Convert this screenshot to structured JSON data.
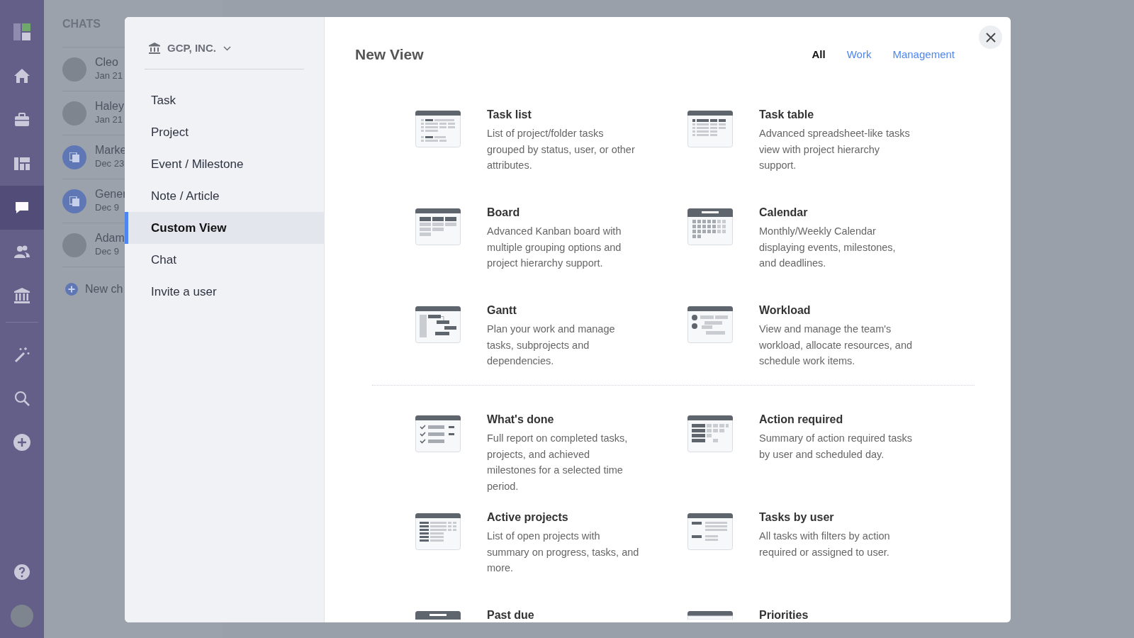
{
  "rail": [
    {
      "kind": "logo"
    },
    {
      "kind": "home",
      "selected": false
    },
    {
      "kind": "briefcase",
      "selected": false
    },
    {
      "kind": "board",
      "selected": false
    },
    {
      "kind": "chat",
      "selected": true
    },
    {
      "kind": "people",
      "selected": false
    },
    {
      "kind": "bank",
      "selected": false
    },
    {
      "kind": "divider"
    },
    {
      "kind": "wand",
      "selected": false
    },
    {
      "kind": "search",
      "selected": false
    },
    {
      "kind": "plus",
      "selected": false
    },
    {
      "kind": "spacer"
    },
    {
      "kind": "help",
      "selected": false
    },
    {
      "kind": "avatar"
    }
  ],
  "chats": {
    "title": "CHATS",
    "items": [
      {
        "name": "Cleo",
        "date": "Jan 21",
        "kind": "photo"
      },
      {
        "name": "Haley",
        "date": "Jan 21",
        "kind": "photo"
      },
      {
        "name": "Marke",
        "date": "Dec 23",
        "kind": "group"
      },
      {
        "name": "Gener",
        "date": "Dec 9",
        "kind": "group"
      },
      {
        "name": "Adam",
        "date": "Dec 9",
        "kind": "photo"
      }
    ],
    "new_chat": "New ch"
  },
  "dialog": {
    "workspace": "GCP, INC.",
    "menu": [
      {
        "label": "Task",
        "selected": false
      },
      {
        "label": "Project",
        "selected": false
      },
      {
        "label": "Event / Milestone",
        "selected": false
      },
      {
        "label": "Note / Article",
        "selected": false
      },
      {
        "label": "Custom View",
        "selected": true
      },
      {
        "label": "Chat",
        "selected": false
      },
      {
        "label": "Invite a user",
        "selected": false
      }
    ],
    "title": "New View",
    "tabs": [
      {
        "label": "All",
        "selected": true
      },
      {
        "label": "Work",
        "selected": false
      },
      {
        "label": "Management",
        "selected": false
      }
    ],
    "groups": [
      [
        {
          "kind": "list",
          "title": "Task list",
          "description": "List of project/folder tasks grouped by status, user, or other attributes."
        },
        {
          "kind": "table",
          "title": "Task table",
          "description": "Advanced spreadsheet-like tasks view with project hierarchy support."
        },
        {
          "kind": "board",
          "title": "Board",
          "description": "Advanced Kanban board with multiple grouping options and project hierarchy support."
        },
        {
          "kind": "calendar",
          "title": "Calendar",
          "description": "Monthly/Weekly Calendar displaying events, milestones, and deadlines."
        },
        {
          "kind": "gantt",
          "title": "Gantt",
          "description": "Plan your work and manage tasks, subprojects and dependencies."
        },
        {
          "kind": "workload",
          "title": "Workload",
          "description": "View and manage the team's workload, allocate resources, and schedule work items."
        }
      ],
      [
        {
          "kind": "checklist",
          "title": "What's done",
          "description": "Full report on completed tasks, projects, and achieved milestones for a selected time period."
        },
        {
          "kind": "matrix",
          "title": "Action required",
          "description": "Summary of action required tasks by user and scheduled day."
        },
        {
          "kind": "projects",
          "title": "Active projects",
          "description": "List of open projects with summary on progress, tasks, and more."
        },
        {
          "kind": "byuser",
          "title": "Tasks by user",
          "description": "All tasks with filters by action required or assigned to user."
        },
        {
          "kind": "pastdue",
          "title": "Past due"
        },
        {
          "kind": "priorities",
          "title": "Priorities"
        }
      ]
    ]
  }
}
